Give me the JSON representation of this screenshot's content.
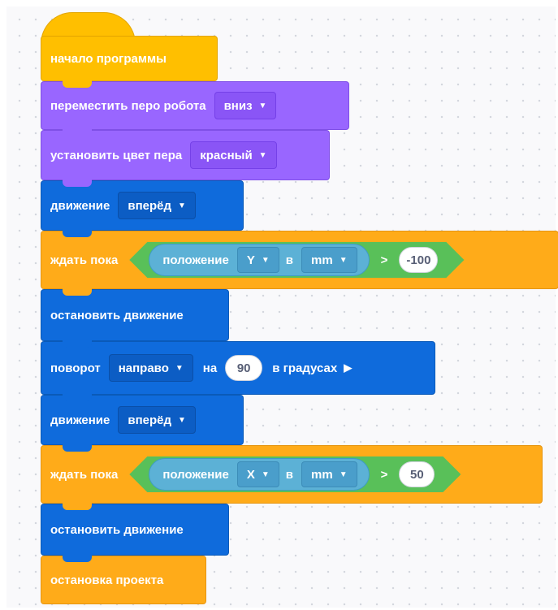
{
  "blocks": {
    "start": {
      "label": "начало программы"
    },
    "pen": {
      "label": "переместить перо робота",
      "value": "вниз"
    },
    "color": {
      "label": "установить цвет пера",
      "value": "красный"
    },
    "move1": {
      "label": "движение",
      "value": "вперёд"
    },
    "wait1": {
      "label": "ждать пока",
      "reporter": "положение",
      "axis": "Y",
      "unit_sep": "в",
      "unit": "mm",
      "op": ">",
      "value": "-100"
    },
    "stop1": {
      "label": "остановить движение"
    },
    "turn": {
      "label": "поворот",
      "direction": "направо",
      "on": "на",
      "degrees": "90",
      "unit": "в градусах"
    },
    "move2": {
      "label": "движение",
      "value": "вперёд"
    },
    "wait2": {
      "label": "ждать пока",
      "reporter": "положение",
      "axis": "X",
      "unit_sep": "в",
      "unit": "mm",
      "op": ">",
      "value": "50"
    },
    "stop2": {
      "label": "остановить движение"
    },
    "end": {
      "label": "остановка проекта"
    }
  },
  "colors": {
    "events": "#ffbf00",
    "pen": "#9966ff",
    "motion": "#0f6bdc",
    "control": "#ffab19",
    "operator": "#59c059",
    "sensing": "#5cb1d6"
  },
  "icons": {
    "dropdown": "chevron-down-icon",
    "play": "play-triangle-icon"
  }
}
